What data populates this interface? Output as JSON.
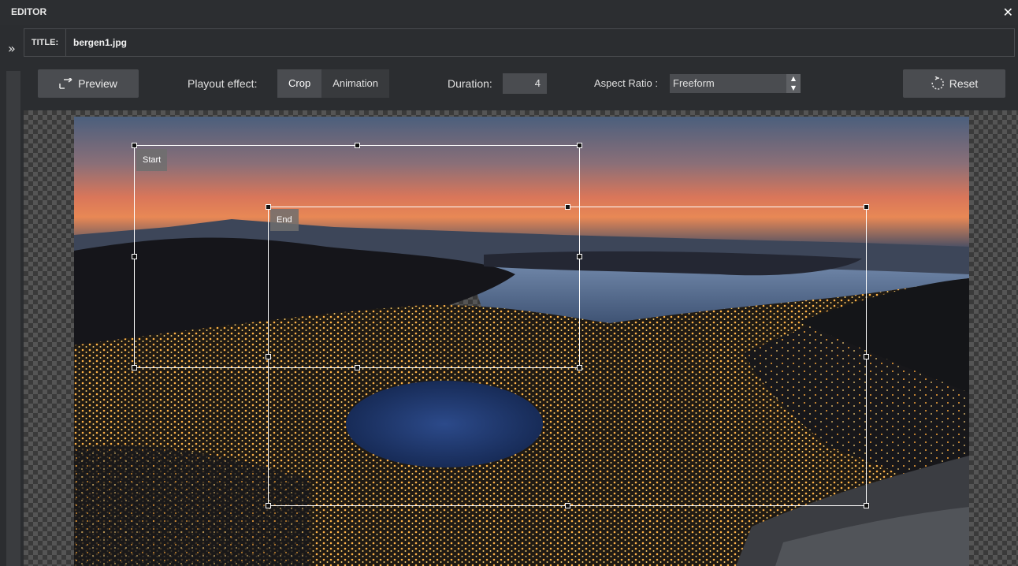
{
  "window": {
    "title": "EDITOR",
    "close_icon": "close-icon"
  },
  "sidebar": {
    "expand_icon": "double-chevron-right-icon"
  },
  "title_row": {
    "label": "TITLE:",
    "value": "bergen1.jpg"
  },
  "toolbar": {
    "preview_label": "Preview",
    "playout_label": "Playout effect:",
    "effects": [
      {
        "label": "Crop",
        "active": true
      },
      {
        "label": "Animation",
        "active": false
      }
    ],
    "duration_label": "Duration:",
    "duration_value": "4",
    "aspect_label": "Aspect Ratio :",
    "aspect_value": "Freeform",
    "reset_label": "Reset"
  },
  "canvas": {
    "start_label": "Start",
    "end_label": "End"
  },
  "colors": {
    "background": "#2b2d30",
    "button": "#4a4c50",
    "crop_border": "#ffffff"
  }
}
